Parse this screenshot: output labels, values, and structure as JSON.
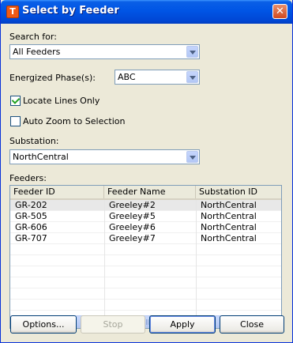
{
  "window": {
    "title": "Select by Feeder",
    "icon": "T",
    "close_glyph": "✕"
  },
  "search": {
    "label": "Search for:",
    "value": "All Feeders"
  },
  "phase": {
    "label": "Energized Phase(s):",
    "value": "ABC"
  },
  "locate_lines": {
    "label": "Locate Lines Only",
    "checked": true
  },
  "auto_zoom": {
    "label": "Auto Zoom to Selection",
    "checked": false
  },
  "substation": {
    "label": "Substation:",
    "value": "NorthCentral"
  },
  "feeders": {
    "label": "Feeders:",
    "columns": [
      "Feeder ID",
      "Feeder Name",
      "Substation ID"
    ],
    "rows": [
      [
        "GR-202",
        "Greeley#2",
        "NorthCentral"
      ],
      [
        "GR-505",
        "Greeley#5",
        "NorthCentral"
      ],
      [
        "GR-606",
        "Greeley#6",
        "NorthCentral"
      ],
      [
        "GR-707",
        "Greeley#7",
        "NorthCentral"
      ]
    ]
  },
  "buttons": {
    "options": "Options...",
    "stop": "Stop",
    "apply": "Apply",
    "close": "Close"
  }
}
